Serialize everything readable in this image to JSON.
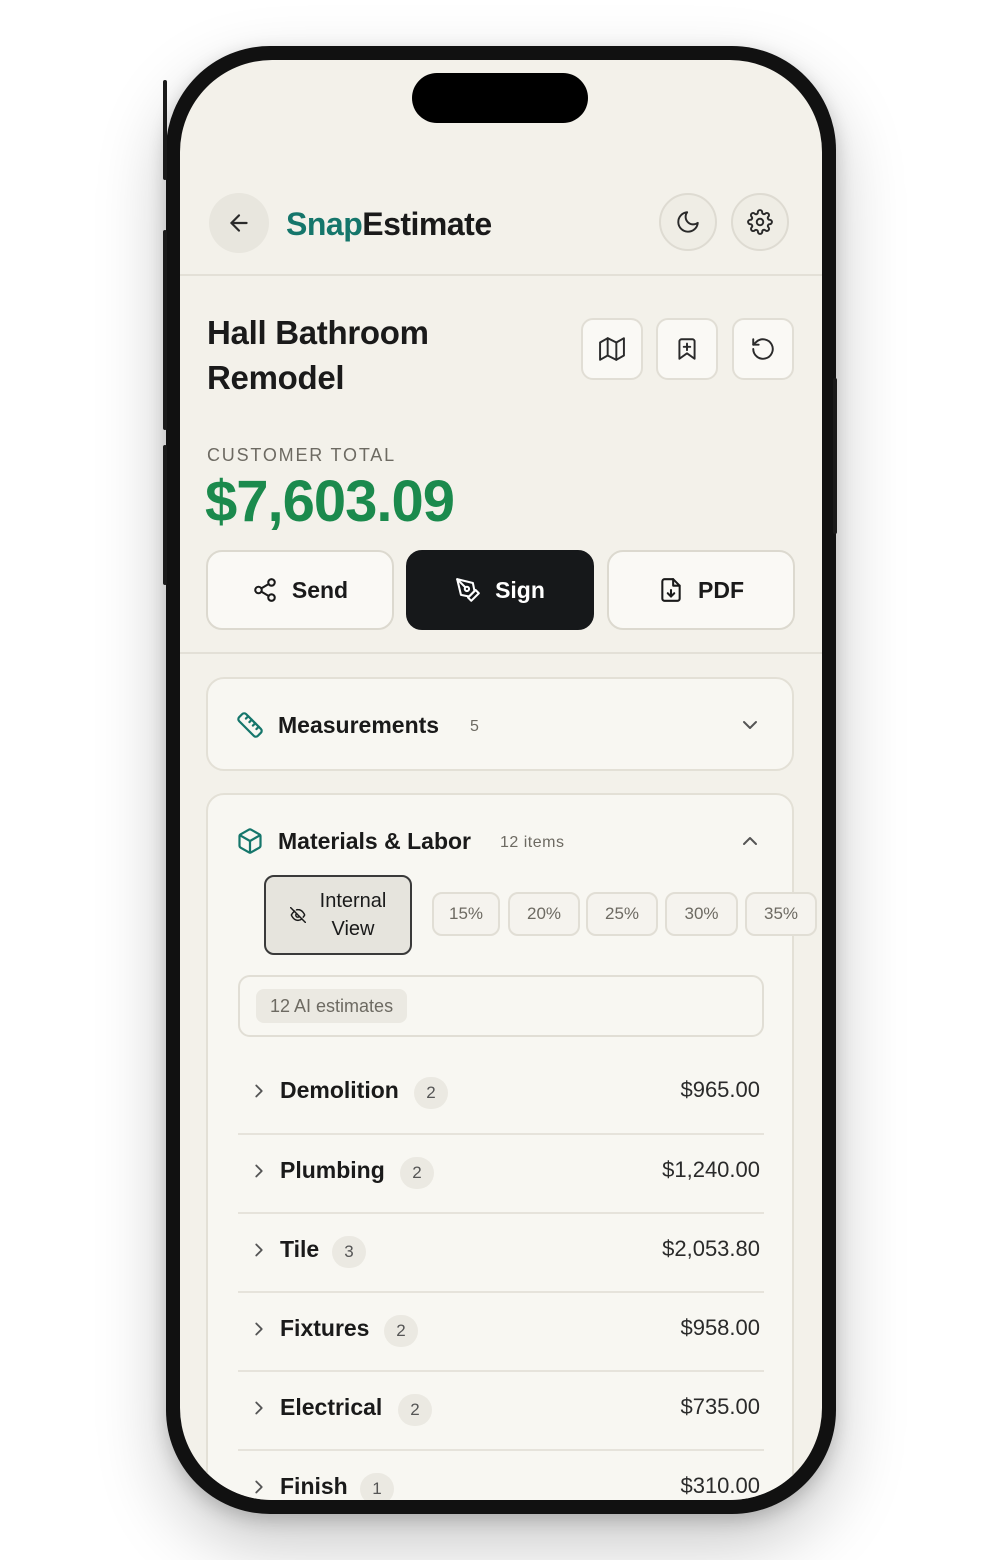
{
  "header": {
    "brand_part1": "Snap",
    "brand_part2": "Estimate"
  },
  "project": {
    "title_line1": "Hall Bathroom",
    "title_line2": "Remodel"
  },
  "totals": {
    "label": "CUSTOMER TOTAL",
    "value": "$7,603.09"
  },
  "actions": {
    "send": "Send",
    "sign": "Sign",
    "pdf": "PDF"
  },
  "measurements": {
    "title": "Measurements",
    "count": "5"
  },
  "materials": {
    "title": "Materials & Labor",
    "count_label": "12 items",
    "internal_view_line1": "Internal",
    "internal_view_line2": "View",
    "markups": [
      "15%",
      "20%",
      "25%",
      "30%",
      "35%"
    ],
    "ai_chip": "12 AI estimates",
    "rows": [
      {
        "name": "Demolition",
        "count": "2",
        "amount": "$965.00"
      },
      {
        "name": "Plumbing",
        "count": "2",
        "amount": "$1,240.00"
      },
      {
        "name": "Tile",
        "count": "3",
        "amount": "$2,053.80"
      },
      {
        "name": "Fixtures",
        "count": "2",
        "amount": "$958.00"
      },
      {
        "name": "Electrical",
        "count": "2",
        "amount": "$735.00"
      },
      {
        "name": "Finish",
        "count": "1",
        "amount": "$310.00"
      }
    ]
  },
  "colors": {
    "brand_teal": "#15766b",
    "total_green": "#1b8a4d",
    "dark_button": "#16181a",
    "screen_bg": "#f3f1ea"
  },
  "icons": {
    "back": "arrow-left-icon",
    "theme": "moon-icon",
    "settings": "gear-icon",
    "map": "map-icon",
    "bookmark": "bookmark-plus-icon",
    "reset": "rotate-ccw-icon",
    "send": "share-icon",
    "sign": "pen-tool-icon",
    "pdf": "file-download-icon",
    "measurements": "ruler-icon",
    "materials": "package-icon",
    "internal_view": "eye-off-icon"
  }
}
